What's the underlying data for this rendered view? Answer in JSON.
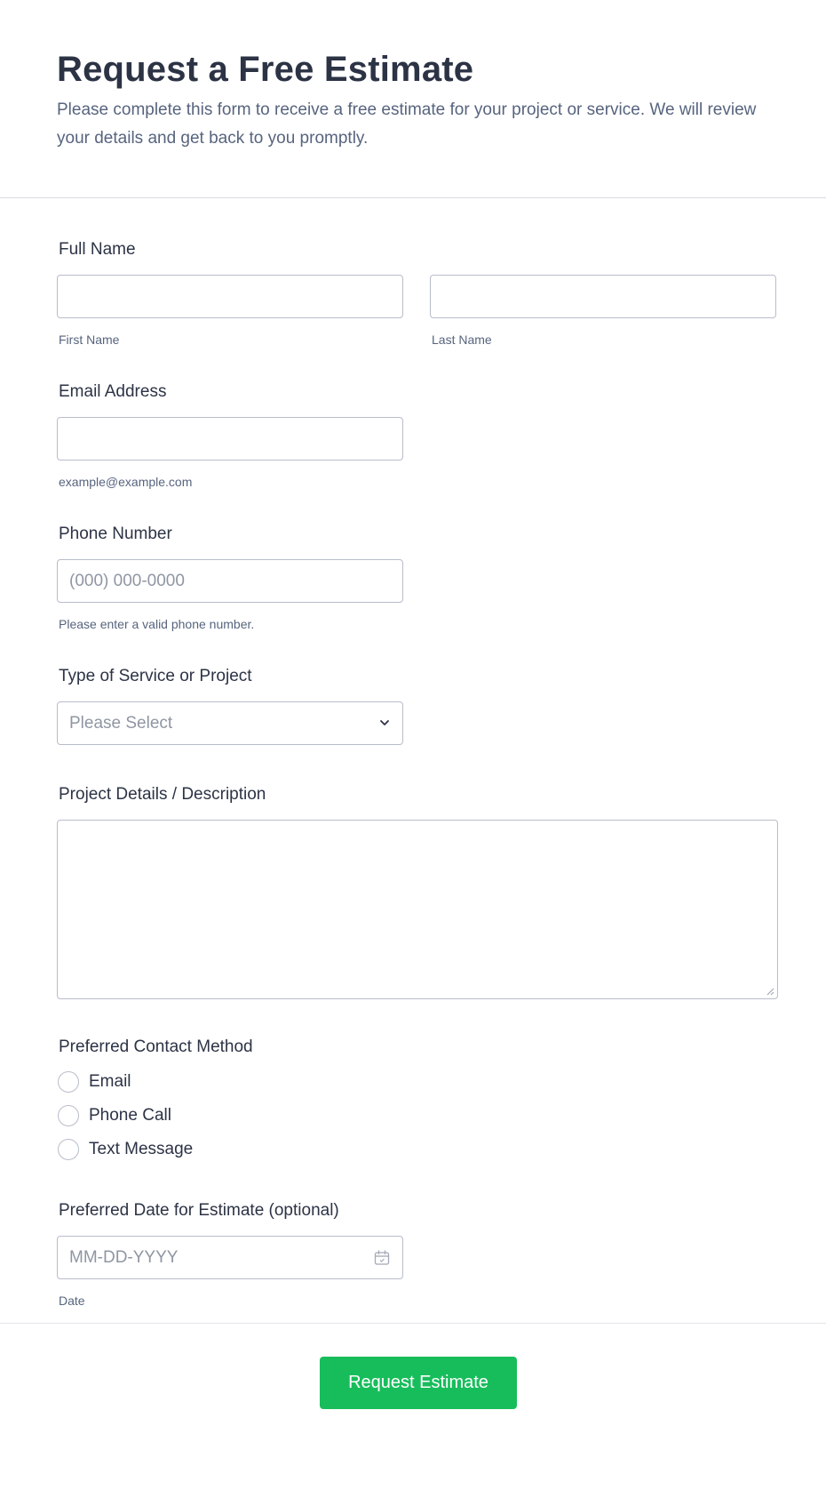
{
  "header": {
    "title": "Request a Free Estimate",
    "subtitle": "Please complete this form to receive a free estimate for your project or service. We will review your details and get back to you promptly."
  },
  "full_name": {
    "label": "Full Name",
    "first_value": "",
    "first_sublabel": "First Name",
    "last_value": "",
    "last_sublabel": "Last Name"
  },
  "email": {
    "label": "Email Address",
    "value": "",
    "sublabel": "example@example.com"
  },
  "phone": {
    "label": "Phone Number",
    "placeholder": "(000) 000-0000",
    "sublabel": "Please enter a valid phone number."
  },
  "service": {
    "label": "Type of Service or Project",
    "selected": "Please Select",
    "icon": "chevron-down-icon"
  },
  "details": {
    "label": "Project Details / Description",
    "value": ""
  },
  "contact_method": {
    "label": "Preferred Contact Method",
    "options": [
      "Email",
      "Phone Call",
      "Text Message"
    ]
  },
  "date": {
    "label": "Preferred Date for Estimate (optional)",
    "placeholder": "MM-DD-YYYY",
    "sublabel": "Date",
    "icon": "calendar-icon"
  },
  "submit": {
    "label": "Request Estimate",
    "color": "#18bd5b"
  }
}
